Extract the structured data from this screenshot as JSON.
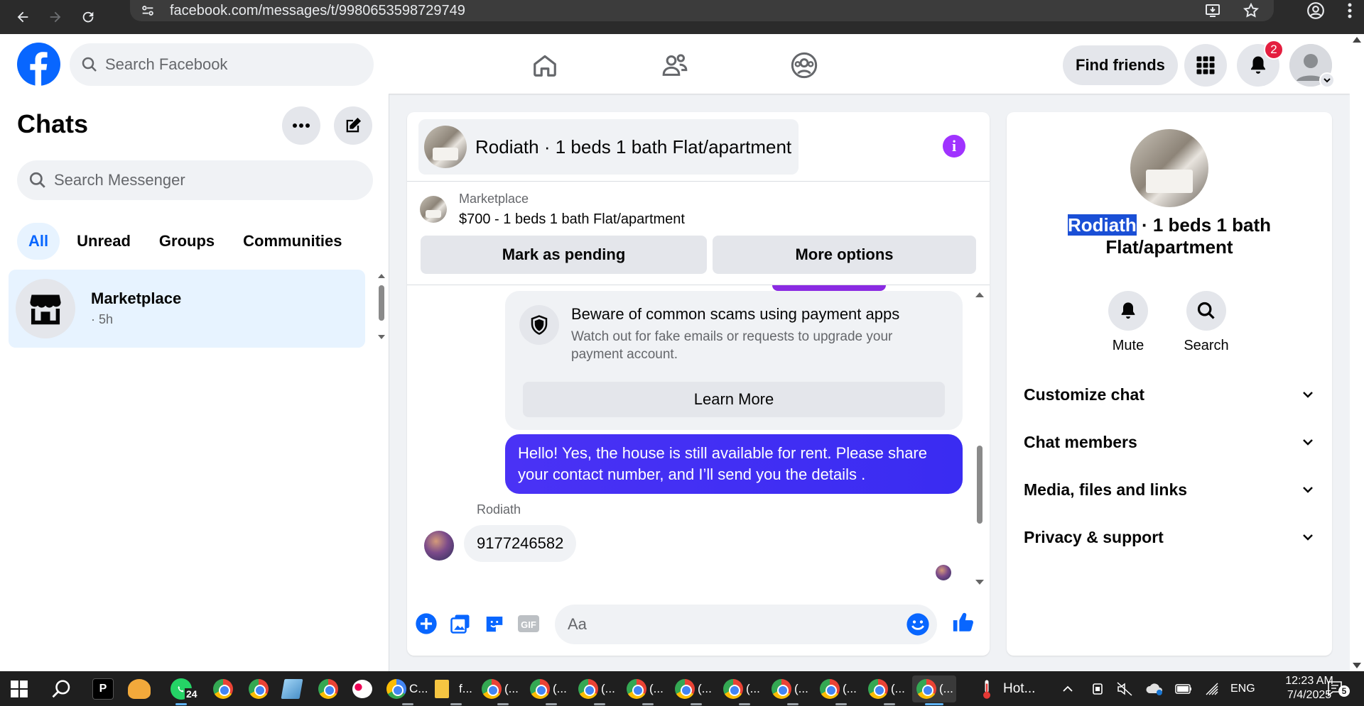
{
  "browser": {
    "url": "facebook.com/messages/t/9980653598729749"
  },
  "header": {
    "search_placeholder": "Search Facebook",
    "find_friends": "Find friends",
    "notification_count": "2"
  },
  "sidebar": {
    "title": "Chats",
    "search_placeholder": "Search Messenger",
    "filters": [
      "All",
      "Unread",
      "Groups",
      "Communities"
    ],
    "active_filter": "All",
    "chats": [
      {
        "name": "Marketplace",
        "time": "· 5h"
      }
    ]
  },
  "conversation": {
    "title": "Rodiath · 1 beds 1 bath Flat/apartment",
    "marketplace_label": "Marketplace",
    "listing": "$700 - 1 beds 1 bath Flat/apartment",
    "mark_pending": "Mark as pending",
    "more_options": "More options",
    "scam_title": "Beware of common scams using payment apps",
    "scam_text": "Watch out for fake emails or requests to upgrade your payment account.",
    "learn_more": "Learn More",
    "outgoing_message": "Hello! Yes, the house is still available for rent. Please share your contact number, and I’ll send you the details .",
    "sender_name": "Rodiath",
    "incoming_message": "9177246582",
    "composer_placeholder": "Aa"
  },
  "info": {
    "title_highlight": "Rodiath",
    "title_rest": " · 1 beds 1 bath Flat/apartment",
    "mute": "Mute",
    "search": "Search",
    "sections": [
      "Customize chat",
      "Chat members",
      "Media, files and links",
      "Privacy & support"
    ]
  },
  "taskbar": {
    "whatsapp_badge": "24",
    "chrome_label_1": "C...",
    "files_label": "f...",
    "chrome_short": "(...",
    "weather": "Hot...",
    "lang": "ENG",
    "time": "12:23 AM",
    "date": "7/4/2025",
    "notif_count": "5"
  },
  "colors": {
    "fb_blue": "#0866ff",
    "message_purple": "#4a32f5",
    "info_purple": "#a033ff",
    "badge_red": "#e41e3f"
  }
}
